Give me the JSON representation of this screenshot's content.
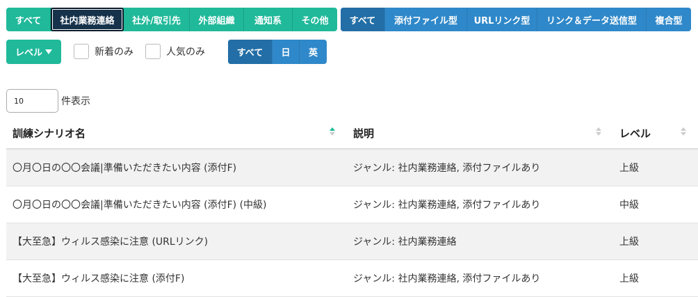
{
  "category_filters": [
    {
      "label": "すべて",
      "active": false
    },
    {
      "label": "社内業務連絡",
      "active": true
    },
    {
      "label": "社外/取引先",
      "active": false
    },
    {
      "label": "外部組織",
      "active": false
    },
    {
      "label": "通知系",
      "active": false
    },
    {
      "label": "その他",
      "active": false
    }
  ],
  "type_filters": [
    {
      "label": "すべて",
      "active": true
    },
    {
      "label": "添付ファイル型",
      "active": false
    },
    {
      "label": "URLリンク型",
      "active": false
    },
    {
      "label": "リンク＆データ送信型",
      "active": false
    },
    {
      "label": "複合型",
      "active": false
    }
  ],
  "level_dropdown": {
    "label": "レベル"
  },
  "checkboxes": {
    "new_only": "新着のみ",
    "popular_only": "人気のみ"
  },
  "lang_filters": [
    {
      "label": "すべて",
      "active": true
    },
    {
      "label": "日",
      "active": false
    },
    {
      "label": "英",
      "active": false
    }
  ],
  "page_length": {
    "value": "10",
    "label": "件表示"
  },
  "table": {
    "headers": {
      "name": "訓練シナリオ名",
      "desc": "説明",
      "level": "レベル"
    },
    "rows": [
      {
        "name": "〇月〇日の〇〇会議|準備いただきたい内容 (添付F)",
        "desc": "ジャンル: 社内業務連絡, 添付ファイルあり",
        "level": "上級"
      },
      {
        "name": "〇月〇日の〇〇会議|準備いただきたい内容 (添付F) (中級)",
        "desc": "ジャンル: 社内業務連絡, 添付ファイルあり",
        "level": "中級"
      },
      {
        "name": "【大至急】ウィルス感染に注意 (URLリンク)",
        "desc": "ジャンル: 社内業務連絡",
        "level": "上級"
      },
      {
        "name": "【大至急】ウィルス感染に注意 (添付F)",
        "desc": "ジャンル: 社内業務連絡, 添付ファイルあり",
        "level": "上級"
      }
    ]
  }
}
